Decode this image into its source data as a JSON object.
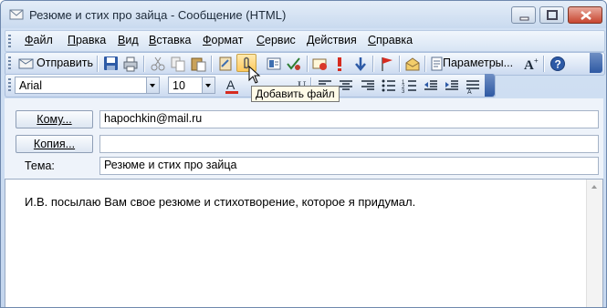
{
  "window": {
    "title": "Резюме и стих про зайца - Сообщение (HTML)"
  },
  "menu": [
    "Файл",
    "Правка",
    "Вид",
    "Вставка",
    "Формат",
    "Сервис",
    "Действия",
    "Справка"
  ],
  "toolbar": {
    "send_label": "Отправить",
    "params_label": "Параметры...",
    "tooltip": "Добавить файл"
  },
  "format": {
    "font": "Arial",
    "size": "10"
  },
  "header": {
    "to_button": "Кому...",
    "cc_button": "Копия...",
    "subject_label": "Тема:",
    "to_value": "hapochkin@mail.ru",
    "cc_value": "",
    "subject_value": "Резюме и стих про зайца"
  },
  "body": {
    "text": "И.В. посылаю Вам свое резюме и стихотворение, которое я придумал."
  }
}
